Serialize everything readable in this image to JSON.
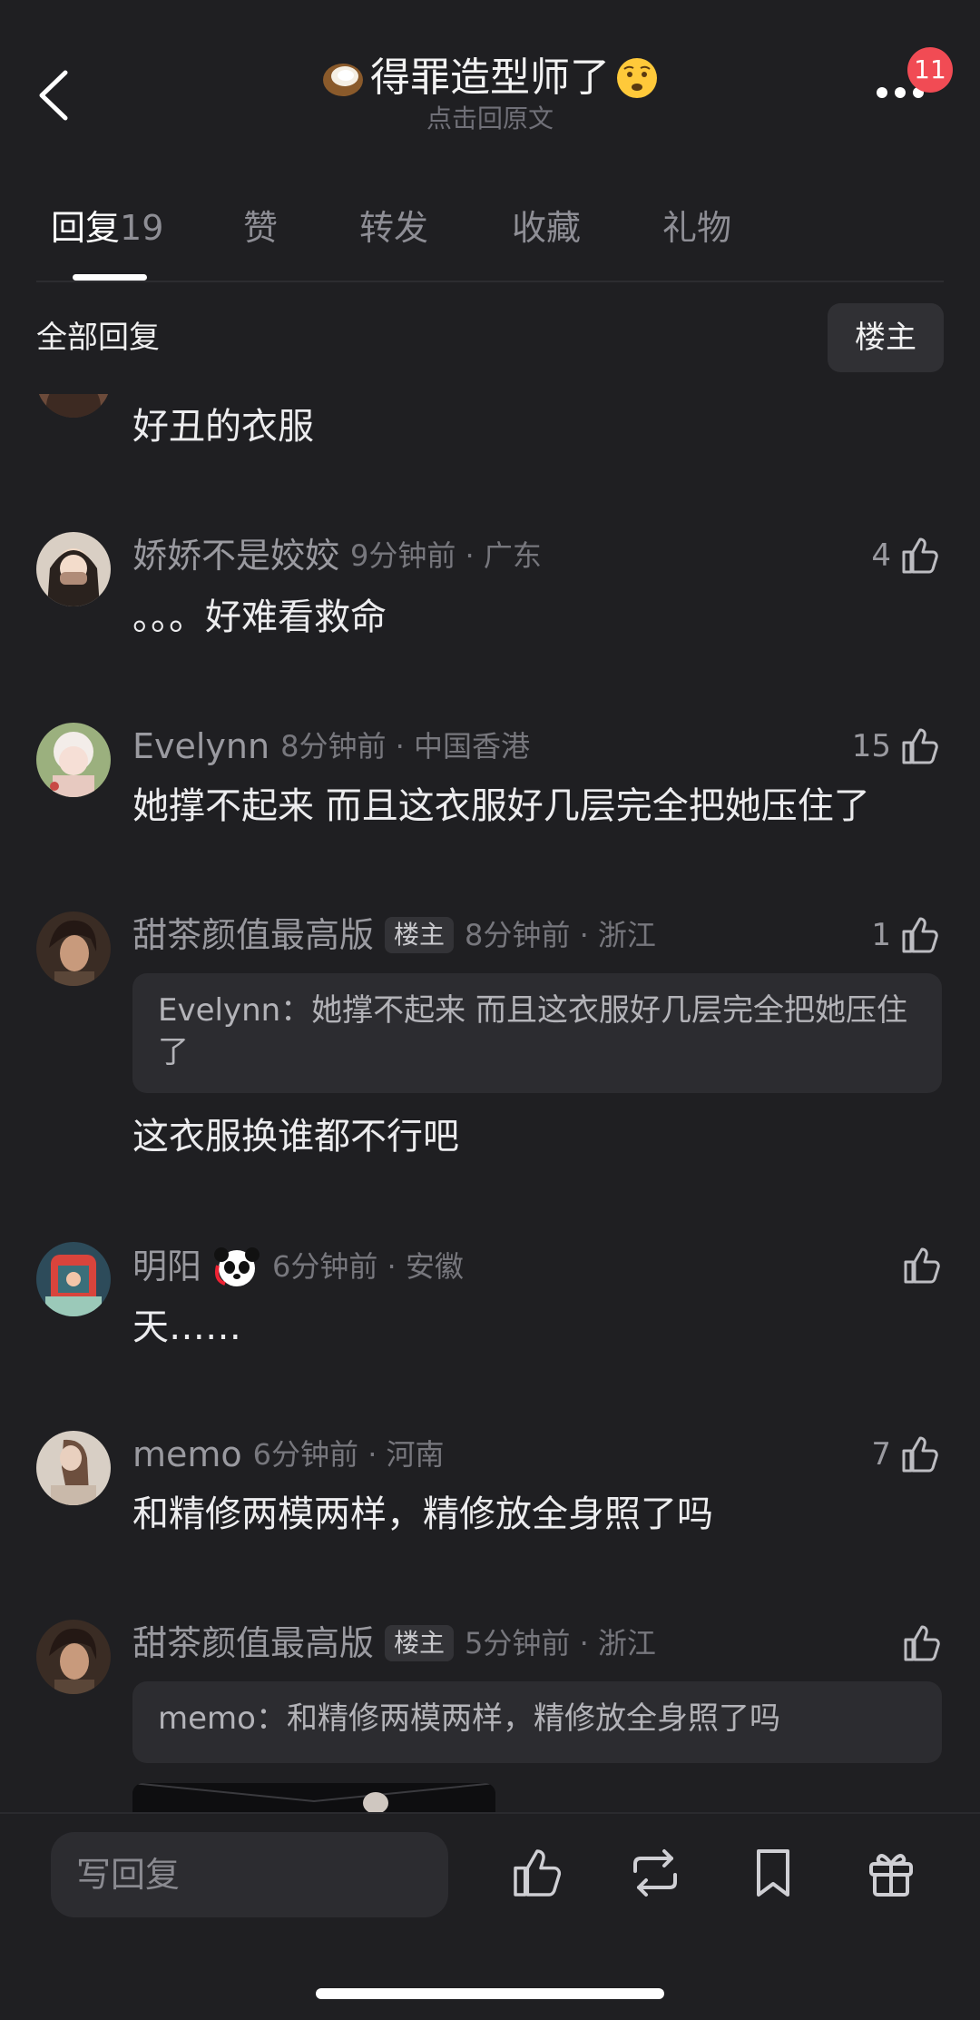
{
  "header": {
    "title": "得罪造型师了",
    "subtitle": "点击回原文",
    "badge_count": "11",
    "title_emoji_left": "coconut-emoji",
    "title_emoji_right": "anxious-face-emoji"
  },
  "tabs": [
    {
      "label": "回复",
      "count": "19",
      "active": true
    },
    {
      "label": "赞"
    },
    {
      "label": "转发"
    },
    {
      "label": "收藏"
    },
    {
      "label": "礼物"
    }
  ],
  "filter": {
    "label": "全部回复",
    "owner_button": "楼主"
  },
  "comments": [
    {
      "text": "好丑的衣服"
    },
    {
      "name": "娇娇不是姣姣",
      "meta": "9分钟前 · 广东",
      "likes": "4",
      "text": "。。。好难看救命"
    },
    {
      "name": "Evelynn",
      "meta": "8分钟前 · 中国香港",
      "likes": "15",
      "text": "她撑不起来 而且这衣服好几层完全把她压住了"
    },
    {
      "name": "甜茶颜值最高版",
      "tag": "楼主",
      "meta": "8分钟前 · 浙江",
      "likes": "1",
      "quote": "Evelynn：她撑不起来 而且这衣服好几层完全把她压住了",
      "text": "这衣服换谁都不行吧"
    },
    {
      "name": "明阳",
      "meta": "6分钟前 · 安徽",
      "likes": "",
      "text": "天……"
    },
    {
      "name": "memo",
      "meta": "6分钟前 · 河南",
      "likes": "7",
      "text": "和精修两模两样，精修放全身照了吗"
    },
    {
      "name": "甜茶颜值最高版",
      "tag": "楼主",
      "meta": "5分钟前 · 浙江",
      "likes": "",
      "quote": "memo：和精修两模两样，精修放全身照了吗"
    }
  ],
  "bottom_bar": {
    "reply_placeholder": "写回复"
  },
  "colors": {
    "background": "#1f1f22",
    "badge": "#f14b54",
    "text_primary": "#ececee",
    "text_secondary": "#9a9aa0"
  }
}
